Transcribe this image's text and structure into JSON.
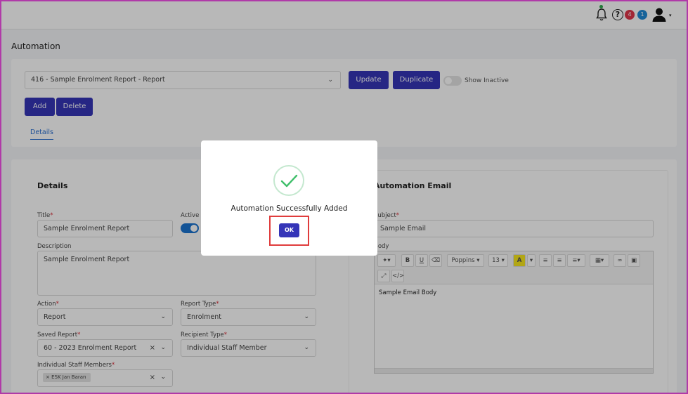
{
  "topbar": {
    "notification_icon": "bell-icon",
    "help_icon": "question-circle-icon",
    "help_glyph": "?",
    "badge_red": "4",
    "badge_blue": "1",
    "user_icon": "user-avatar-icon",
    "caret": "▾"
  },
  "page": {
    "title": "Automation"
  },
  "toolbar": {
    "automation_select_value": "416 - Sample Enrolment Report - Report",
    "update_label": "Update",
    "duplicate_label": "Duplicate",
    "show_inactive_label": "Show Inactive",
    "add_label": "Add",
    "delete_label": "Delete",
    "tab_details": "Details"
  },
  "details": {
    "section_title": "Details",
    "title_label": "Title",
    "title_value": "Sample Enrolment Report",
    "active_label": "Active",
    "description_label": "Description",
    "description_value": "Sample Enrolment Report",
    "action_label": "Action",
    "action_value": "Report",
    "report_type_label": "Report Type",
    "report_type_value": "Enrolment",
    "saved_report_label": "Saved Report",
    "saved_report_value": "60 - 2023 Enrolment Report",
    "recipient_type_label": "Recipient Type",
    "recipient_type_value": "Individual Staff Member",
    "staff_members_label": "Individual Staff Members",
    "staff_chip": "ESK Jan Baran",
    "required_mark": "*"
  },
  "email": {
    "section_title": "Automation Email",
    "subject_label": "Subject",
    "subject_value": "Sample Email",
    "body_label": "Body",
    "font_name": "Poppins",
    "font_size": "13",
    "body_text": "Sample Email Body"
  },
  "modal": {
    "message": "Automation Successfully Added",
    "ok_label": "OK"
  },
  "colors": {
    "primary": "#3535b8",
    "success": "#2eaa4b",
    "highlight": "#e03c3c"
  }
}
